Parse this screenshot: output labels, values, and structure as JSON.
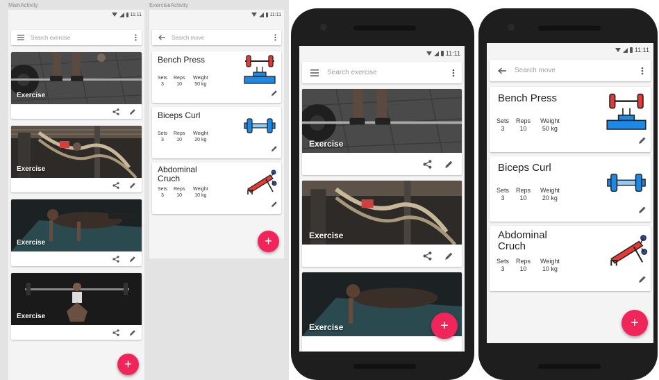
{
  "main_activity": {
    "label": "MainActivity",
    "time": "11:11",
    "search_placeholder": "Search exercise",
    "cards": [
      {
        "label": "Exercise",
        "scene": "deadlift"
      },
      {
        "label": "Exercise",
        "scene": "rope"
      },
      {
        "label": "Exercise",
        "scene": "pushup"
      },
      {
        "label": "Exercise",
        "scene": "squat"
      }
    ],
    "fab_label": "+"
  },
  "exercise_activity": {
    "label": "ExerciseActivity",
    "time": "11:11",
    "search_placeholder": "Search move",
    "stat_headers": [
      "Sets",
      "Reps",
      "Weight"
    ],
    "moves": [
      {
        "name": "Bench Press",
        "sets": "3",
        "reps": "10",
        "weight": "50 kg",
        "icon": "bench-press-icon"
      },
      {
        "name": "Biceps Curl",
        "sets": "3",
        "reps": "10",
        "weight": "20 kg",
        "icon": "dumbbell-icon"
      },
      {
        "name": "Abdominal Cruch",
        "name_line1": "Abdominal",
        "name_line2": "Cruch",
        "sets": "3",
        "reps": "10",
        "weight": "10 kg",
        "icon": "ab-bench-icon"
      }
    ],
    "fab_label": "+"
  },
  "colors": {
    "accent": "#f0265b",
    "icon_red": "#e53935",
    "icon_blue": "#1e88e5",
    "card_bg": "#ffffff",
    "screen_bg": "#f4f4f4"
  }
}
